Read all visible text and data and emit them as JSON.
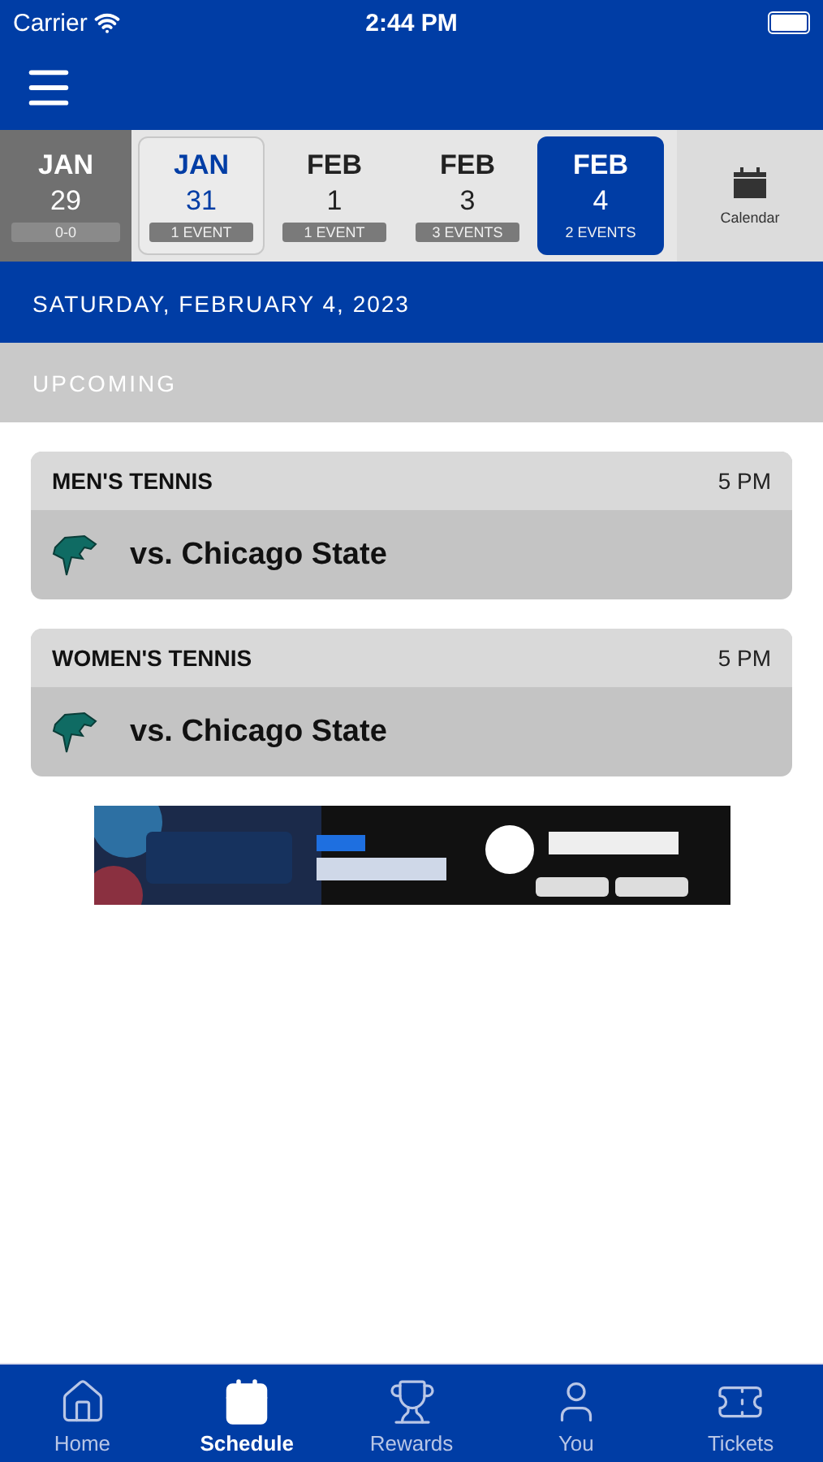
{
  "status_bar": {
    "carrier": "Carrier",
    "time": "2:44 PM"
  },
  "date_strip": [
    {
      "month": "JAN",
      "day": "29",
      "tag": "0-0",
      "kind": "past",
      "today": false,
      "selected": false
    },
    {
      "month": "JAN",
      "day": "31",
      "tag": "1 EVENT",
      "kind": "day",
      "today": true,
      "selected": false
    },
    {
      "month": "FEB",
      "day": "1",
      "tag": "1 EVENT",
      "kind": "day",
      "today": false,
      "selected": false
    },
    {
      "month": "FEB",
      "day": "3",
      "tag": "3 EVENTS",
      "kind": "day",
      "today": false,
      "selected": false
    },
    {
      "month": "FEB",
      "day": "4",
      "tag": "2 EVENTS",
      "kind": "day",
      "today": false,
      "selected": true
    }
  ],
  "calendar_button": "Calendar",
  "date_heading": "SATURDAY, FEBRUARY 4, 2023",
  "section": "UPCOMING",
  "events": [
    {
      "sport": "MEN'S TENNIS",
      "time": "5 PM",
      "opponent": "vs. Chicago State"
    },
    {
      "sport": "WOMEN'S TENNIS",
      "time": "5 PM",
      "opponent": "vs. Chicago State"
    }
  ],
  "tab_bar": [
    {
      "label": "Home",
      "selected": false
    },
    {
      "label": "Schedule",
      "selected": true
    },
    {
      "label": "Rewards",
      "selected": false
    },
    {
      "label": "You",
      "selected": false
    },
    {
      "label": "Tickets",
      "selected": false
    }
  ]
}
